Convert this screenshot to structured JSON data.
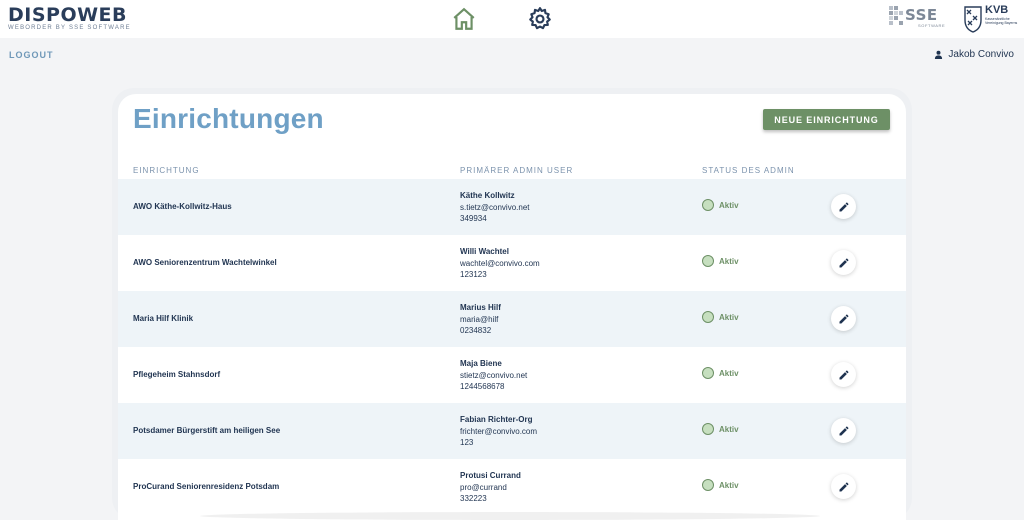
{
  "header": {
    "brand_title": "DISPOWEB",
    "brand_subtitle": "WEBORDER BY SSE SOFTWARE",
    "nav": [
      "home-icon",
      "gear-icon"
    ],
    "partner_logos": {
      "sse": {
        "text": "SSE",
        "sub": "SOFTWARE"
      },
      "kvb": {
        "text": "KVB",
        "sub": "Kassenärztliche Vereinigung Bayerns"
      }
    }
  },
  "subbar": {
    "logout_label": "LOGOUT",
    "user_name": "Jakob Convivo"
  },
  "main": {
    "title": "Einrichtungen",
    "new_button_label": "NEUE EINRICHTUNG",
    "columns": [
      "EINRICHTUNG",
      "PRIMÄRER ADMIN USER",
      "STATUS DES ADMIN"
    ],
    "rows": [
      {
        "name": "AWO Käthe-Kollwitz-Haus",
        "admin_name": "Käthe Kollwitz",
        "admin_email": "s.tietz@convivo.net",
        "admin_id": "349934",
        "status": "Aktiv"
      },
      {
        "name": "AWO Seniorenzentrum Wachtelwinkel",
        "admin_name": "Willi Wachtel",
        "admin_email": "wachtel@convivo.com",
        "admin_id": "123123",
        "status": "Aktiv"
      },
      {
        "name": "Maria Hilf Klinik",
        "admin_name": "Marius Hilf",
        "admin_email": "maria@hilf",
        "admin_id": "0234832",
        "status": "Aktiv"
      },
      {
        "name": "Pflegeheim Stahnsdorf",
        "admin_name": "Maja Biene",
        "admin_email": "stietz@convivo.net",
        "admin_id": "1244568678",
        "status": "Aktiv"
      },
      {
        "name": "Potsdamer Bürgerstift am heiligen See",
        "admin_name": "Fabian Richter-Org",
        "admin_email": "frichter@convivo.com",
        "admin_id": "123",
        "status": "Aktiv"
      },
      {
        "name": "ProCurand Seniorenresidenz Potsdam",
        "admin_name": "Protusi Currand",
        "admin_email": "pro@currand",
        "admin_id": "332223",
        "status": "Aktiv"
      }
    ]
  },
  "colors": {
    "title": "#6fa0c6",
    "primary_button": "#6d9066",
    "status_active": "#6d9066",
    "row_alt": "#eef4f8",
    "text": "#1f3350"
  }
}
